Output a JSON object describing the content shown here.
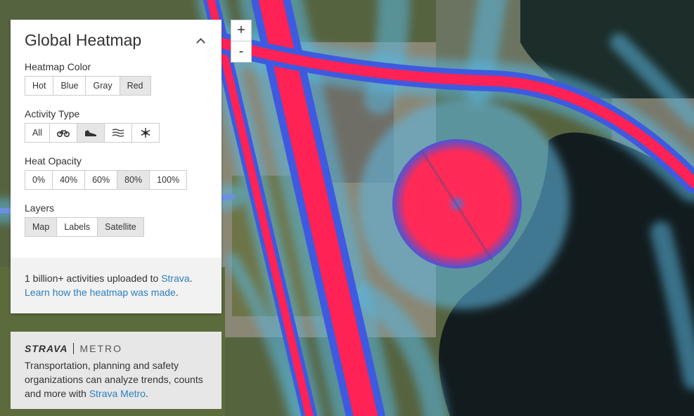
{
  "panel": {
    "title": "Global Heatmap",
    "heatmap_color": {
      "label": "Heatmap Color",
      "options": [
        "Hot",
        "Blue",
        "Gray",
        "Red"
      ],
      "selected": "Red"
    },
    "activity_type": {
      "label": "Activity Type",
      "options": [
        {
          "label": "All",
          "icon": null
        },
        {
          "label": "",
          "icon": "bike-icon"
        },
        {
          "label": "",
          "icon": "run-shoe-icon"
        },
        {
          "label": "",
          "icon": "water-icon"
        },
        {
          "label": "",
          "icon": "snowflake-icon"
        }
      ],
      "selected": "run-shoe-icon"
    },
    "heat_opacity": {
      "label": "Heat Opacity",
      "options": [
        "0%",
        "40%",
        "60%",
        "80%",
        "100%"
      ],
      "selected": "80%"
    },
    "layers": {
      "label": "Layers",
      "options": [
        "Map",
        "Labels",
        "Satellite"
      ],
      "selected": [
        "Map",
        "Satellite"
      ]
    },
    "footer": {
      "text1": "1 billion+ activities uploaded to ",
      "link1": "Strava",
      "text1_end": ".",
      "link2": "Learn how the heatmap was made",
      "text2_end": "."
    }
  },
  "metro": {
    "logo_brand": "STRAVA",
    "logo_product": "METRO",
    "text": "Transportation, planning and safety organizations can analyze trends, counts and more with ",
    "link": "Strava Metro",
    "text_end": "."
  },
  "zoom": {
    "in": "+",
    "out": "-"
  },
  "colors": {
    "accent_link": "#2a7fc1",
    "heat_red": "#ff2255",
    "heat_blue": "#3a6fe0"
  }
}
